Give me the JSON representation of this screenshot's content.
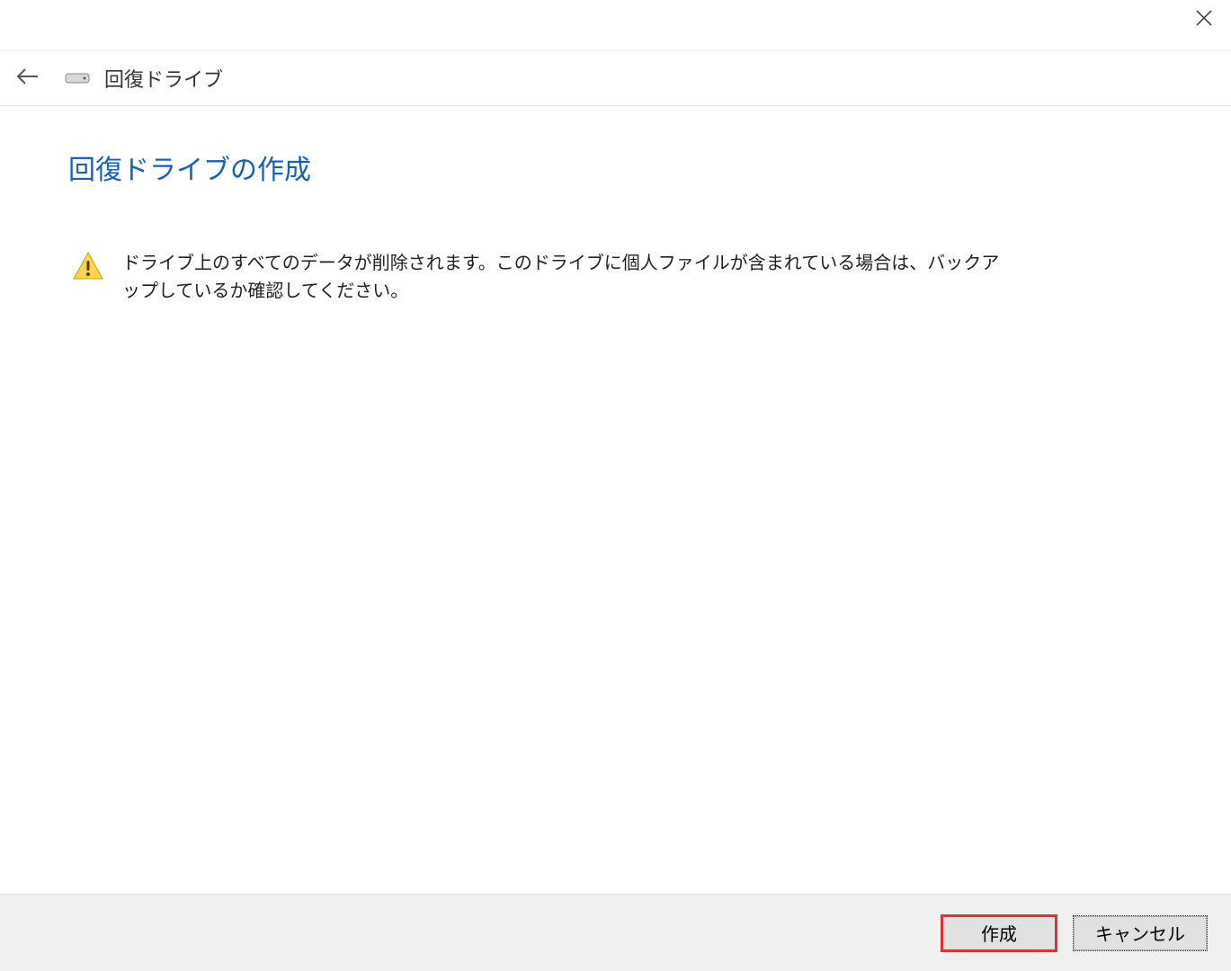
{
  "header": {
    "window_title": "回復ドライブ"
  },
  "content": {
    "page_title": "回復ドライブの作成",
    "warning_text": "ドライブ上のすべてのデータが削除されます。このドライブに個人ファイルが含まれている場合は、バックアップしているか確認してください。"
  },
  "footer": {
    "create_label": "作成",
    "cancel_label": "キャンセル"
  },
  "colors": {
    "title_accent": "#1461b8",
    "highlight_outline": "#d33"
  }
}
